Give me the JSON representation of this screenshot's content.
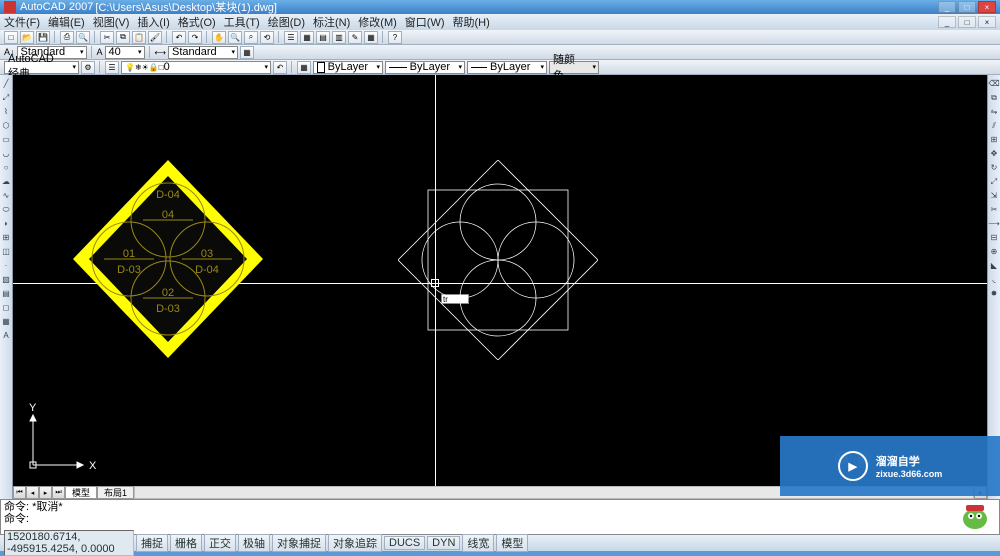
{
  "titlebar": {
    "app": "AutoCAD 2007",
    "file": "[C:\\Users\\Asus\\Desktop\\某块(1).dwg]"
  },
  "menu": [
    "文件(F)",
    "编辑(E)",
    "视图(V)",
    "插入(I)",
    "格式(O)",
    "工具(T)",
    "绘图(D)",
    "标注(N)",
    "修改(M)",
    "窗口(W)",
    "帮助(H)"
  ],
  "tb2": {
    "style": "Standard",
    "font_a": "A",
    "size": "40",
    "dimstyle": "Standard"
  },
  "tb3": {
    "workspace": "AutoCAD 经典",
    "layer": "0",
    "color_label": "ByLayer",
    "ltype_label": "ByLayer",
    "lweight_label": "ByLayer",
    "bycolor": "随颜色"
  },
  "drawing": {
    "labels": {
      "d04_top": "D-04",
      "num04": "04",
      "num01": "01",
      "d03_left": "D-03",
      "num03": "03",
      "d04_right": "D-04",
      "num02": "02",
      "d03_bottom": "D-03"
    },
    "colors": {
      "yellow": "#ffff00",
      "dark": "#2a2a10",
      "line": "#ffffff"
    },
    "cmd_input": "tr"
  },
  "ucs": {
    "x": "X",
    "y": "Y"
  },
  "tabs": {
    "model": "模型",
    "layout1": "布局1"
  },
  "cmd": {
    "line1": "命令: *取消*",
    "line2": "命令:"
  },
  "status": {
    "coord": "1520180.6714, -495915.4254, 0.0000",
    "btns": [
      "捕捉",
      "栅格",
      "正交",
      "极轴",
      "对象捕捉",
      "对象追踪",
      "DUCS",
      "DYN",
      "线宽",
      "模型"
    ]
  },
  "watermark": {
    "title": "溜溜自学",
    "sub": "zixue.3d66.com"
  }
}
